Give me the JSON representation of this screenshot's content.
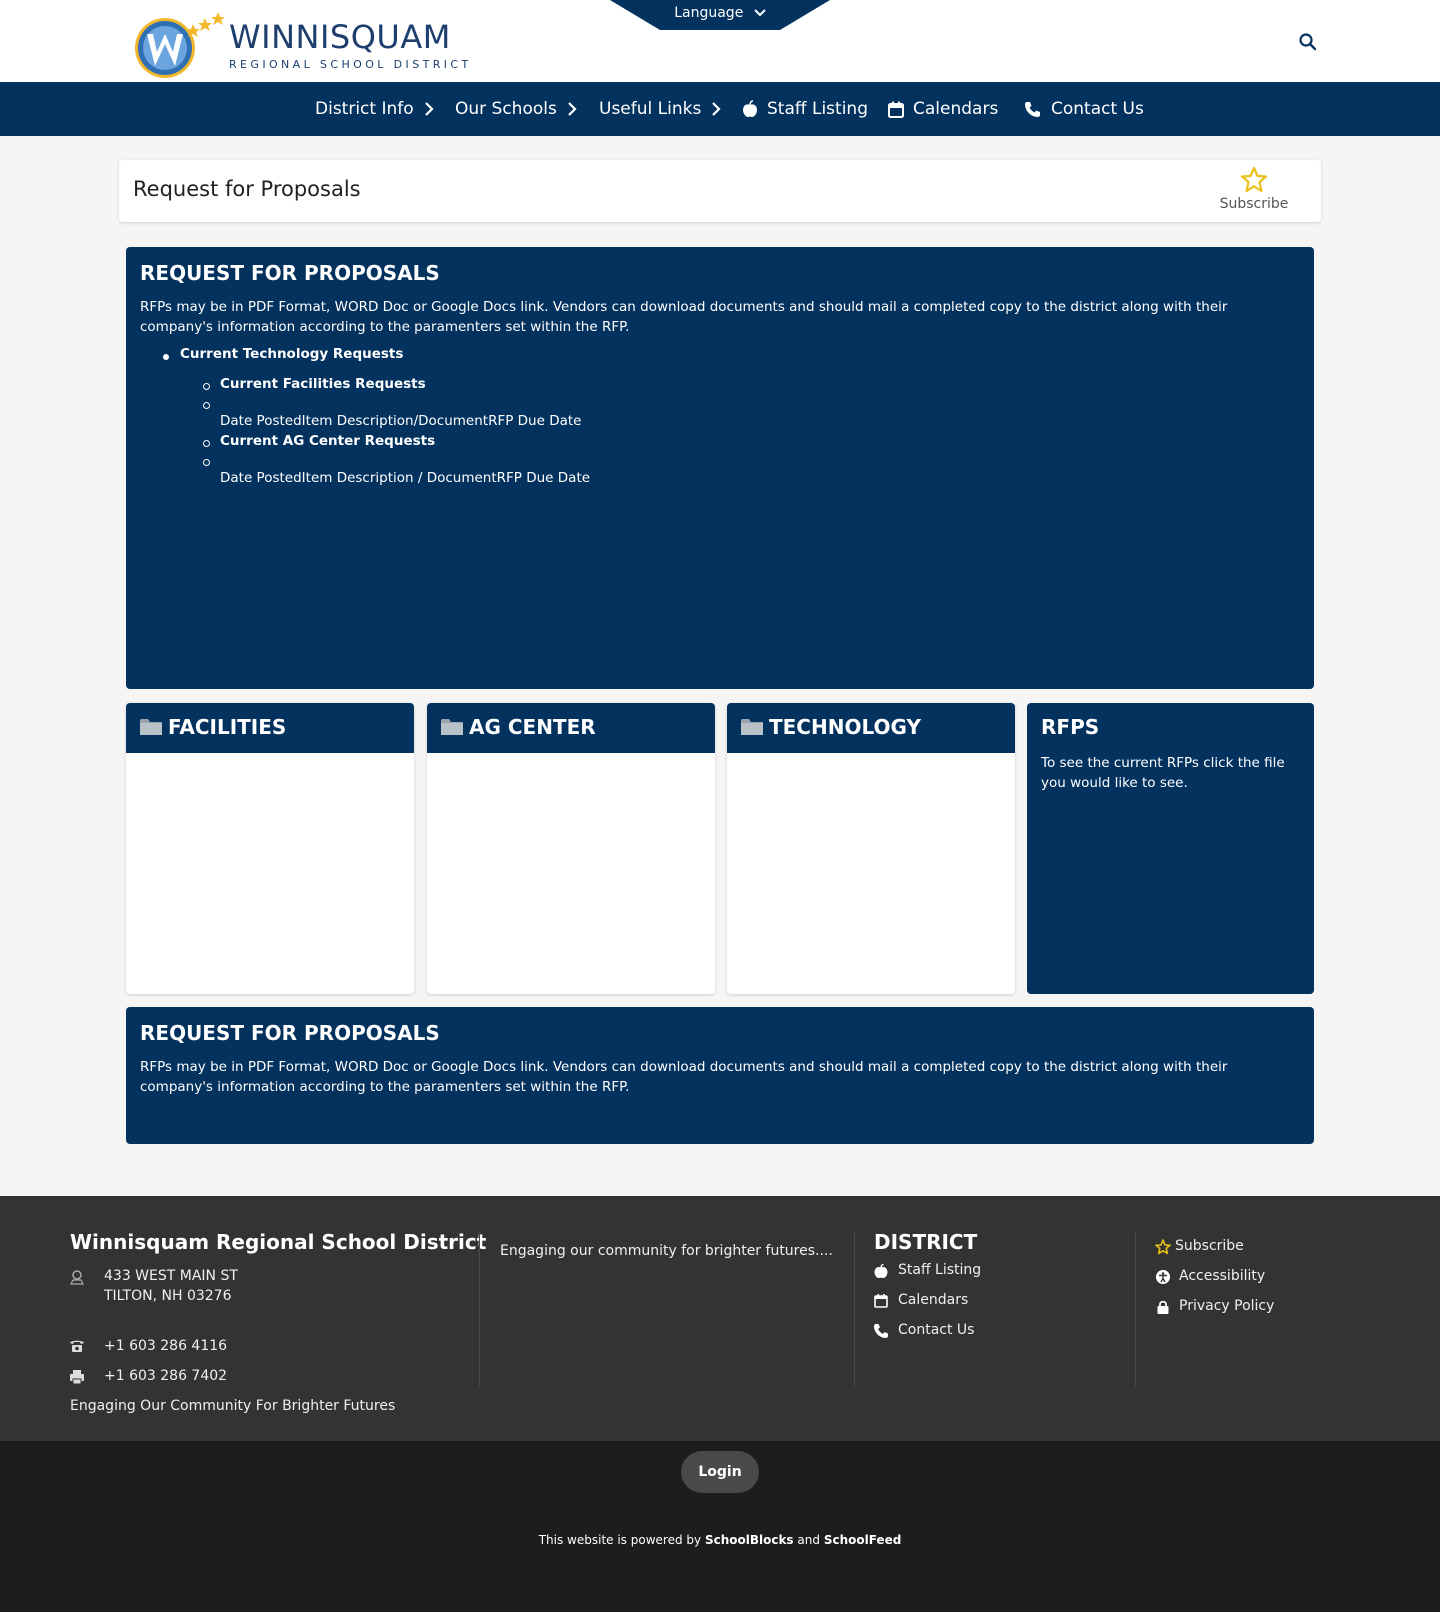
{
  "header": {
    "logo_title": "WINNISQUAM",
    "logo_subtitle": "REGIONAL SCHOOL DISTRICT",
    "language_label": "Language"
  },
  "nav": {
    "items": [
      {
        "label": "District Info",
        "icon": "chevron-right-icon"
      },
      {
        "label": "Our Schools",
        "icon": "chevron-right-icon"
      },
      {
        "label": "Useful Links",
        "icon": "chevron-right-icon"
      },
      {
        "label": "Staff Listing",
        "icon": "apple-icon"
      },
      {
        "label": "Calendars",
        "icon": "calendar-icon"
      },
      {
        "label": "Contact Us",
        "icon": "phone-icon"
      }
    ]
  },
  "page": {
    "title": "Request for Proposals",
    "subscribe_label": "Subscribe"
  },
  "rfp_block_1": {
    "heading": "REQUEST FOR PROPOSALS",
    "text": "RFPs may be in PDF Format, WORD Doc or Google Docs link. Vendors can download documents and should mail a completed copy to the district along with their company's information according to the paramenters set within the RFP.",
    "list": {
      "item_1": "Current Technology Requests",
      "sub_1": "Current Facilities Requests",
      "sub_2_text": "Date PostedItem Description/DocumentRFP Due Date",
      "sub_3": "Current AG Center Requests",
      "sub_4_text": "Date PostedItem Description / DocumentRFP Due Date"
    }
  },
  "cards": {
    "facilities": "FACILITIES",
    "ag_center": "AG CENTER",
    "technology": "TECHNOLOGY",
    "rfps_heading": "RFPS",
    "rfps_text": "To see the current RFPs click the file you would like to see."
  },
  "rfp_block_2": {
    "heading": "REQUEST FOR PROPOSALS",
    "text": "RFPs may be in PDF Format, WORD Doc or Google Docs link. Vendors can download documents and should mail a completed copy to the district along with their company's information according to the paramenters set within the RFP."
  },
  "footer": {
    "district_name": "Winnisquam Regional School District",
    "address_line1": "433 WEST MAIN ST",
    "address_line2": "TILTON, NH 03276",
    "phone": "+1 603 286 4116",
    "fax": "+1 603 286 7402",
    "motto": "Engaging Our Community For Brighter Futures",
    "tagline": "Engaging our community for brighter futures....",
    "district_heading": "DISTRICT",
    "district_links": [
      "Staff Listing",
      "Calendars",
      "Contact Us"
    ],
    "misc_links": [
      "Subscribe",
      "Accessibility",
      "Privacy Policy"
    ],
    "login_label": "Login",
    "powered_prefix": "This website is powered by",
    "powered_brand1": "SchoolBlocks",
    "powered_and": "and",
    "powered_brand2": "SchoolFeed"
  },
  "colors": {
    "navy": "#03325f",
    "star_gold": "#e8c21a",
    "footer_bg": "#333331"
  }
}
